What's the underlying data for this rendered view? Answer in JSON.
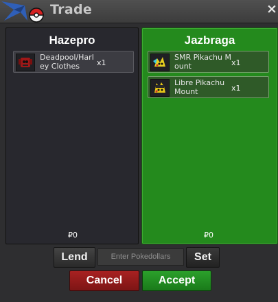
{
  "window": {
    "title": "Trade",
    "close_label": "×"
  },
  "left_panel": {
    "player": "Hazepro",
    "items": [
      {
        "name": "Deadpool/Harley Clothes",
        "qty": "x1",
        "icon": "deadpool-clothes-icon"
      }
    ],
    "money": "₽0"
  },
  "right_panel": {
    "player": "Jazbraga",
    "items": [
      {
        "name": "SMR Pikachu Mount",
        "qty": "x1",
        "icon": "smr-pikachu-mount-icon"
      },
      {
        "name": "Libre Pikachu Mount",
        "qty": "x1",
        "icon": "libre-pikachu-mount-icon"
      }
    ],
    "money": "₽0"
  },
  "controls": {
    "lend_label": "Lend",
    "money_placeholder": "Enter Pokedollars",
    "set_label": "Set",
    "cancel_label": "Cancel",
    "accept_label": "Accept"
  },
  "colors": {
    "accept_panel": "#248a1d",
    "cancel": "#a82121",
    "accept": "#2ba02b"
  }
}
